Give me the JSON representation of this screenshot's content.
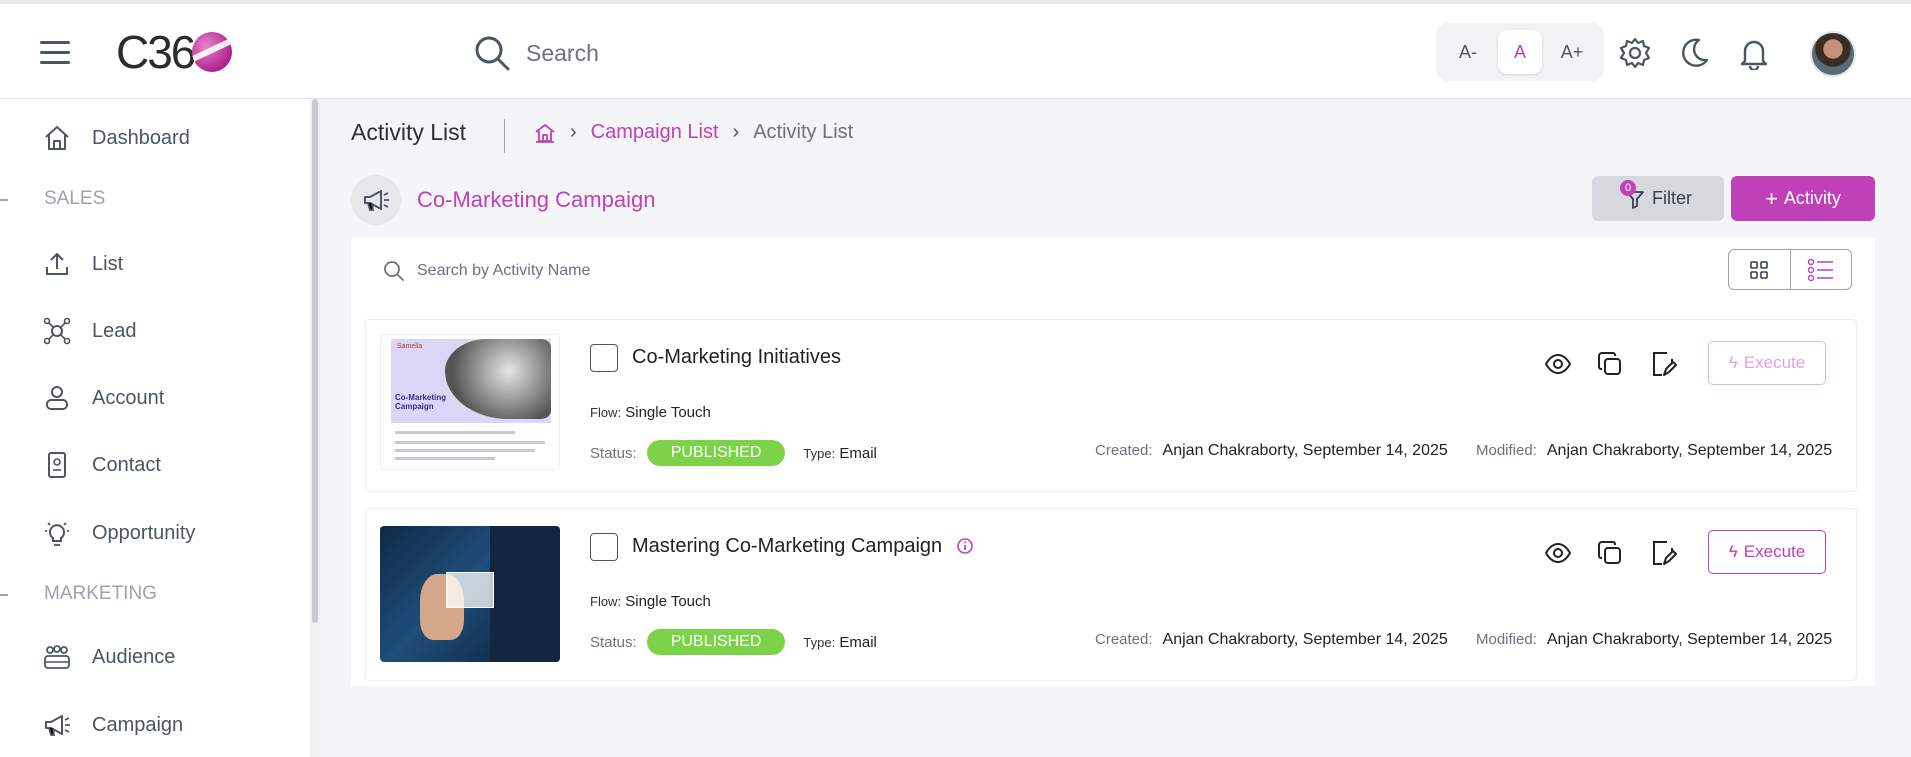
{
  "app": {
    "logo_text": "C36"
  },
  "header": {
    "search": {
      "placeholder": "Search"
    },
    "font_sizes": [
      "A-",
      "A",
      "A+"
    ],
    "icons": [
      "settings-icon",
      "moon-icon",
      "bell-icon"
    ]
  },
  "sidebar": {
    "items": [
      {
        "label": "Dashboard",
        "icon": "home-icon"
      },
      {
        "section": "SALES"
      },
      {
        "label": "List",
        "icon": "upload-icon"
      },
      {
        "label": "Lead",
        "icon": "network-icon"
      },
      {
        "label": "Account",
        "icon": "account-icon"
      },
      {
        "label": "Contact",
        "icon": "contact-card-icon"
      },
      {
        "label": "Opportunity",
        "icon": "lightbulb-icon"
      },
      {
        "section": "MARKETING"
      },
      {
        "label": "Audience",
        "icon": "audience-icon"
      },
      {
        "label": "Campaign",
        "icon": "megaphone-icon"
      }
    ]
  },
  "page": {
    "title": "Activity List",
    "breadcrumb": {
      "link": "Campaign List",
      "current": "Activity List"
    },
    "campaign_title": "Co-Marketing Campaign",
    "filter": {
      "label": "Filter",
      "count": "0"
    },
    "add_button": "Activity",
    "search_placeholder": "Search by Activity Name"
  },
  "activities": [
    {
      "title": "Co-Marketing Initiatives",
      "flow_label": "Flow:",
      "flow": "Single Touch",
      "status_label": "Status:",
      "status": "PUBLISHED",
      "type_label": "Type:",
      "type": "Email",
      "created_label": "Created:",
      "created": "Anjan Chakraborty, September 14, 2025",
      "modified_label": "Modified:",
      "modified": "Anjan Chakraborty, September 14, 2025",
      "execute": "Execute",
      "thumb_text": {
        "logo": "Samella",
        "title": "Co-Marketing\nCampaign"
      }
    },
    {
      "title": "Mastering Co-Marketing Campaign",
      "flow_label": "Flow:",
      "flow": "Single Touch",
      "status_label": "Status:",
      "status": "PUBLISHED",
      "type_label": "Type:",
      "type": "Email",
      "created_label": "Created:",
      "created": "Anjan Chakraborty, September 14, 2025",
      "modified_label": "Modified:",
      "modified": "Anjan Chakraborty, September 14, 2025",
      "execute": "Execute"
    }
  ],
  "colors": {
    "accent": "#c040b8",
    "published": "#7cd34a"
  }
}
